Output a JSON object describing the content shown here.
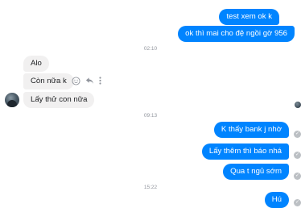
{
  "messages": {
    "out_1": "test xem ok k",
    "out_2": "ok thì mai cho đệ ngồi gờ 956",
    "in_1": "Alo",
    "in_2": "Còn nữa k",
    "in_3": "Lấy thử con nữa",
    "out_3": "K thấy bank j nhờ",
    "out_4": "Lấy thêm thì báo nhá",
    "out_5": "Qua t ngủ sớm",
    "out_6": "Hú"
  },
  "timestamps": {
    "t1": "02:10",
    "t2": "09:13",
    "t3": "15:22"
  },
  "icons": {
    "react": "smiley-icon",
    "reply": "reply-icon",
    "more": "more-icon",
    "status": "check-circle-icon"
  },
  "colors": {
    "outgoing": "#0084ff",
    "incoming": "#f1f0f0",
    "status_grey": "#bcc0c4"
  }
}
